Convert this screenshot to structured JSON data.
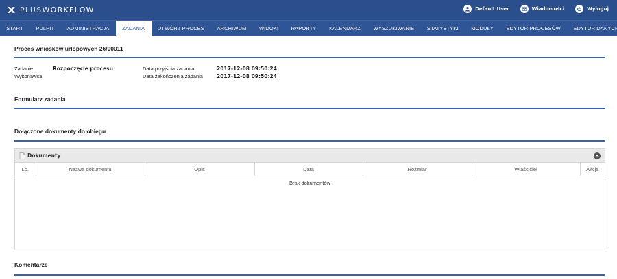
{
  "app": {
    "logo_prefix": "PLUS",
    "logo_suffix": "WORKFLOW",
    "icon": "x-cross-icon"
  },
  "top_actions": [
    {
      "label": "Default User",
      "icon": "user-icon"
    },
    {
      "label": "Wiadomości",
      "icon": "mail-icon"
    },
    {
      "label": "Wyloguj",
      "icon": "power-icon"
    }
  ],
  "nav": [
    "START",
    "PULPIT",
    "ADMINISTRACJA",
    "ZADANIA",
    "UTWÓRZ PROCES",
    "ARCHIWUM",
    "WIDOKI",
    "RAPORTY",
    "KALENDARZ",
    "WYSZUKIWANIE",
    "STATYSTYKI",
    "MODUŁY",
    "EDYTOR PROCESÓW",
    "EDYTOR DANYCH"
  ],
  "nav_active_index": 3,
  "process": {
    "title": "Proces wniosków urlopowych 26/00011",
    "task_label": "Zadanie",
    "task_value": "Rozpoczęcie procesu",
    "executor_label": "Wykonawca",
    "executor_value": "",
    "received_label": "Data przyjścia zadania",
    "received_value": "2017-12-08 09:50:24",
    "finished_label": "Data zakończenia zadania",
    "finished_value": "2017-12-08 09:50:24"
  },
  "sections": {
    "form": "Formularz zadania",
    "attached": "Dołączone dokumenty do obiegu",
    "comments": "Komentarze"
  },
  "documents": {
    "panel_title": "Dokumenty",
    "columns": [
      "Lp.",
      "Nazwa dokumentu",
      "Opis",
      "Data",
      "Rozmiar",
      "Właściciel",
      "Akcja"
    ],
    "empty_message": "Brak dokumentów"
  },
  "colors": {
    "topbar": "#2b4f8c",
    "navbar": "#2f5597",
    "rule": "#3a62a8"
  }
}
